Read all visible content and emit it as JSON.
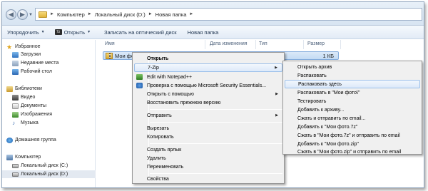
{
  "address": {
    "crumbs": [
      "Компьютер",
      "Локальный диск (D:)",
      "Новая папка"
    ]
  },
  "toolbar": {
    "organize": "Упорядочить",
    "open": "Открыть",
    "burn": "Записать на оптический диск",
    "new_folder": "Новая папка"
  },
  "nav": {
    "favorites": "Избранное",
    "downloads": "Загрузки",
    "recent": "Недавние места",
    "desktop": "Рабочий стол",
    "libraries": "Библиотеки",
    "video": "Видео",
    "documents": "Документы",
    "images": "Изображения",
    "music": "Музыка",
    "homegroup": "Домашняя группа",
    "computer": "Компьютер",
    "drive_c": "Локальный диск (C:)",
    "drive_d": "Локальный диск (D:)"
  },
  "columns": {
    "name": "Имя",
    "date": "Дата изменения",
    "type": "Тип",
    "size": "Размер"
  },
  "file": {
    "name": "Мои фото",
    "size": "1 КБ"
  },
  "context_menu": {
    "open": "Открыть",
    "zip": "7-Zip",
    "notepad": "Edit with Notepad++",
    "scan": "Проверка с помощью Microsoft Security Essentials...",
    "open_with": "Открыть с помощью",
    "restore": "Восстановить прежнюю версию",
    "send_to": "Отправить",
    "cut": "Вырезать",
    "copy": "Копировать",
    "shortcut": "Создать ярлык",
    "delete": "Удалить",
    "rename": "Переименовать",
    "properties": "Свойства"
  },
  "zip_menu": {
    "open_archive": "Открыть архив",
    "extract": "Распаковать",
    "extract_here": "Распаковать здесь",
    "extract_to": "Распаковать в \"Мои фото\\\"",
    "test": "Тестировать",
    "add": "Добавить к архиву...",
    "compress_email": "Сжать и отправить по email...",
    "add_7z": "Добавить к \"Мои фото.7z\"",
    "compress_7z_email": "Сжать в \"Мои фото.7z\" и отправить по email",
    "add_zip": "Добавить к \"Мои фото.zip\"",
    "compress_zip_email": "Сжать в \"Мои фото.zip\" и отправить по email"
  }
}
